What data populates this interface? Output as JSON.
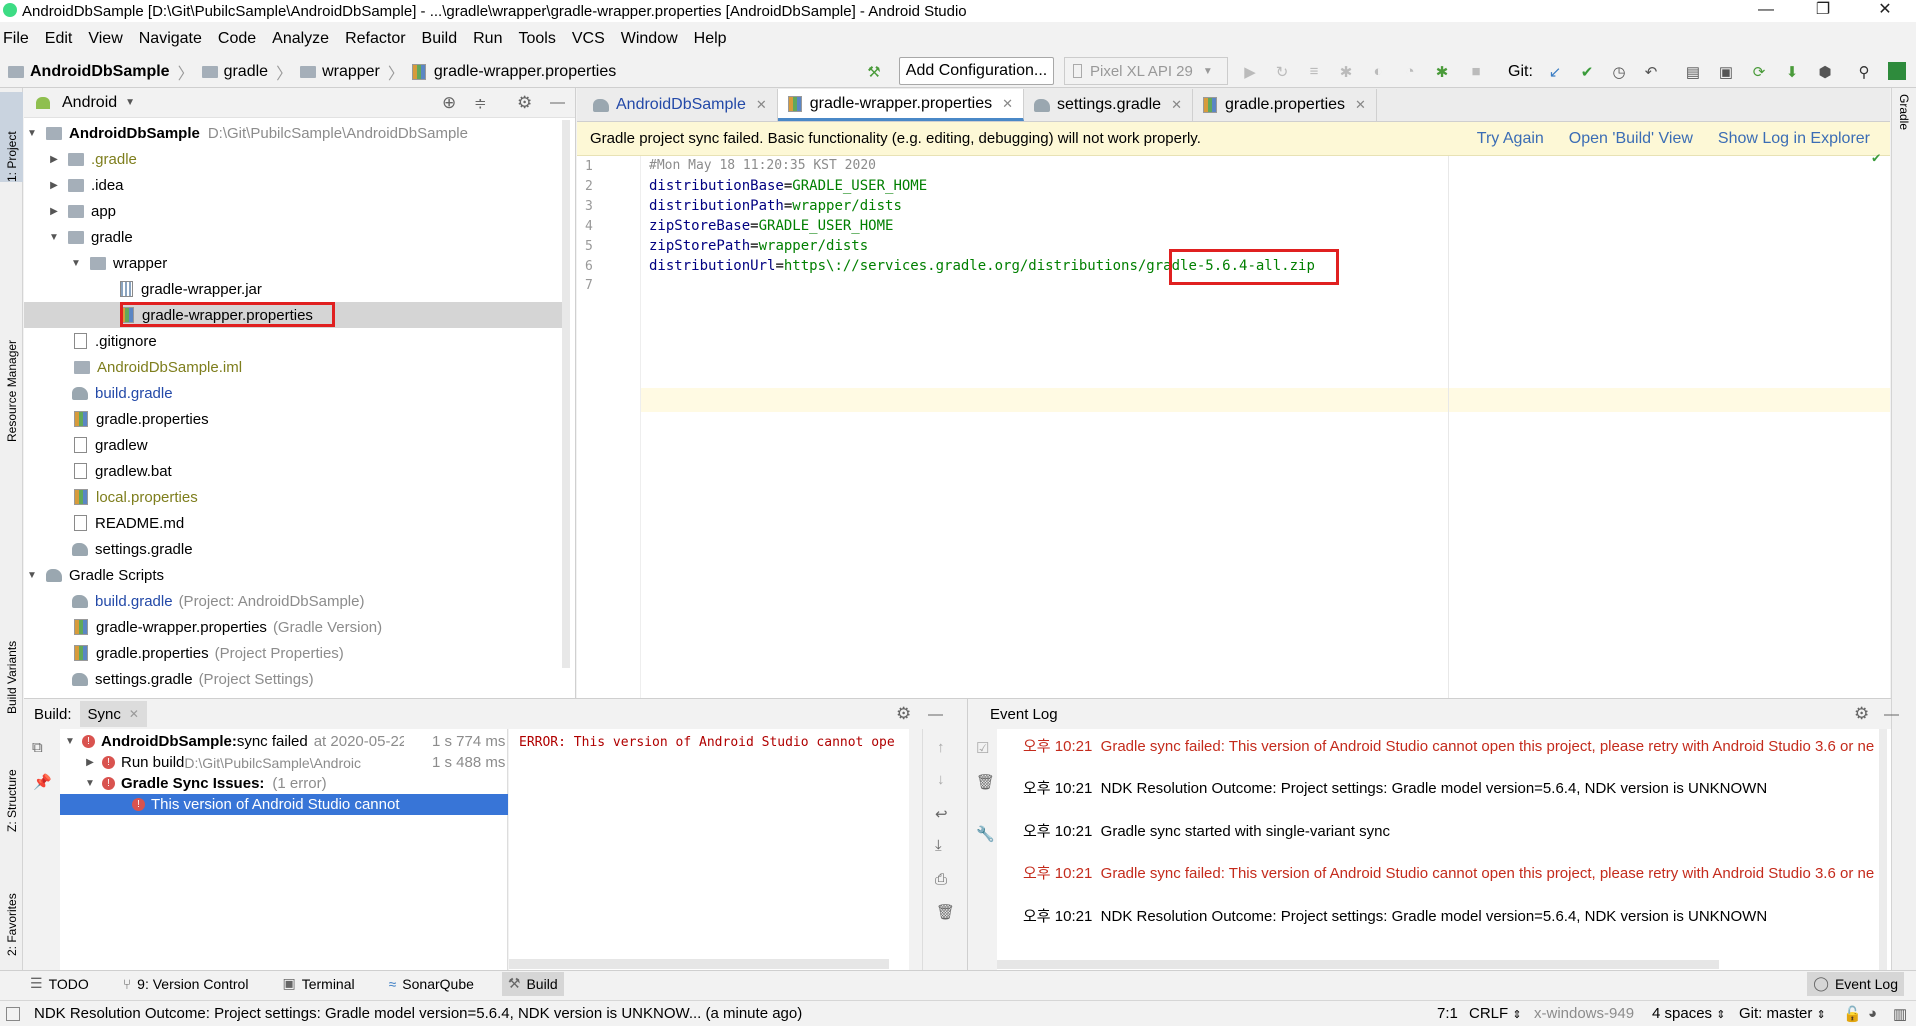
{
  "window": {
    "title": "AndroidDbSample [D:\\Git\\PubilcSample\\AndroidDbSample] - ...\\gradle\\wrapper\\gradle-wrapper.properties [AndroidDbSample] - Android Studio",
    "min": "—",
    "max": "❐",
    "close": "✕"
  },
  "menu": [
    "File",
    "Edit",
    "View",
    "Navigate",
    "Code",
    "Analyze",
    "Refactor",
    "Build",
    "Run",
    "Tools",
    "VCS",
    "Window",
    "Help"
  ],
  "breadcrumb": [
    "AndroidDbSample",
    "gradle",
    "wrapper",
    "gradle-wrapper.properties"
  ],
  "toolbar": {
    "config": "Add Configuration...",
    "device": "Pixel XL API 29",
    "git": "Git:"
  },
  "left_strip": {
    "project": "1: Project",
    "resource": "Resource Manager",
    "variants": "Build Variants",
    "structure": "Z: Structure",
    "favorites": "2: Favorites"
  },
  "right_strip": {
    "gradle": "Gradle"
  },
  "project": {
    "view": "Android",
    "root": {
      "name": "AndroidDbSample",
      "path": "D:\\Git\\PubilcSample\\AndroidDbSample"
    },
    "items": [
      ".gradle",
      ".idea",
      "app",
      "gradle",
      "wrapper",
      "gradle-wrapper.jar",
      "gradle-wrapper.properties",
      ".gitignore",
      "AndroidDbSample.iml",
      "build.gradle",
      "gradle.properties",
      "gradlew",
      "gradlew.bat",
      "local.properties",
      "README.md",
      "settings.gradle"
    ],
    "scripts": {
      "title": "Gradle Scripts",
      "items": [
        {
          "name": "build.gradle",
          "note": "(Project: AndroidDbSample)"
        },
        {
          "name": "gradle-wrapper.properties",
          "note": "(Gradle Version)"
        },
        {
          "name": "gradle.properties",
          "note": "(Project Properties)"
        },
        {
          "name": "settings.gradle",
          "note": "(Project Settings)"
        }
      ]
    }
  },
  "tabs": [
    "AndroidDbSample",
    "gradle-wrapper.properties",
    "settings.gradle",
    "gradle.properties"
  ],
  "banner": {
    "text": "Gradle project sync failed. Basic functionality (e.g. editing, debugging) will not work properly.",
    "try_again": "Try Again",
    "open_build": "Open 'Build' View",
    "show_log": "Show Log in Explorer"
  },
  "code": {
    "line_numbers": [
      "1",
      "2",
      "3",
      "4",
      "5",
      "6",
      "7"
    ],
    "l1": "#Mon May 18 11:20:35 KST 2020",
    "l2k": "distributionBase",
    "l2v": "GRADLE_USER_HOME",
    "l3k": "distributionPath",
    "l3v": "wrapper/dists",
    "l4k": "zipStoreBase",
    "l4v": "GRADLE_USER_HOME",
    "l5k": "zipStorePath",
    "l5v": "wrapper/dists",
    "l6k": "distributionUrl",
    "l6v": "https\\://services.gradle.org/distributions/gradle-5.6.4-all.zip"
  },
  "build": {
    "label": "Build:",
    "tab": "Sync",
    "rows": [
      {
        "name": "AndroidDbSample:",
        "text": " sync failed",
        "at": "at 2020-05-22",
        "time": "1 s 774 ms"
      },
      {
        "name": "Run build",
        "text": " D:\\Git\\PubilcSample\\Androic",
        "time": "1 s 488 ms"
      },
      {
        "name": "Gradle Sync Issues:",
        "text": "(1 error)"
      },
      {
        "name": "This version of Android Studio cannot"
      }
    ],
    "output": "ERROR: This version of Android Studio cannot ope"
  },
  "event_log": {
    "title": "Event Log",
    "entries": [
      {
        "time": "오후 10:21",
        "text": "Gradle sync failed: This version of Android Studio cannot open this project, please retry with Android Studio 3.6 or ne",
        "error": true
      },
      {
        "time": "오후 10:21",
        "text": "NDK Resolution Outcome: Project settings: Gradle model version=5.6.4, NDK version is UNKNOWN",
        "error": false
      },
      {
        "time": "오후 10:21",
        "text": "Gradle sync started with single-variant sync",
        "error": false
      },
      {
        "time": "오후 10:21",
        "text": "Gradle sync failed: This version of Android Studio cannot open this project, please retry with Android Studio 3.6 or ne",
        "error": true
      },
      {
        "time": "오후 10:21",
        "text": "NDK Resolution Outcome: Project settings: Gradle model version=5.6.4, NDK version is UNKNOWN",
        "error": false
      }
    ]
  },
  "toolwindows": [
    "TODO",
    "9: Version Control",
    "Terminal",
    "SonarQube",
    "Build",
    "Event Log"
  ],
  "status": {
    "message": "NDK Resolution Outcome: Project settings: Gradle model version=5.6.4, NDK version is UNKNOW... (a minute ago)",
    "pos": "7:1",
    "eol": "CRLF",
    "encoding": "x-windows-949",
    "indent": "4 spaces",
    "branch": "Git: master"
  },
  "colors": {
    "error": "#c42b1c",
    "link": "#3b6db5",
    "highlight_box": "#e02020",
    "selection": "#3875d7"
  }
}
